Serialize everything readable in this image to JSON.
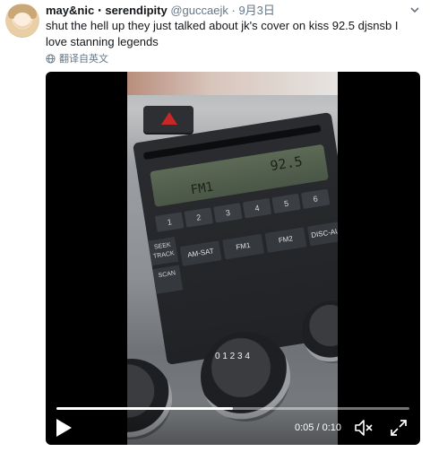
{
  "tweet": {
    "display_name": "may&nic ⋅ serendipity",
    "handle": "@guccaejk",
    "separator": "·",
    "date": "9月3日",
    "text": "shut the hell up they just talked about jk's cover on kiss 92.5 djsnsb I love stanning legends",
    "translate_label": "翻译自英文"
  },
  "video": {
    "current_time": "0:05",
    "total_time": "0:10",
    "time_separator": " / ",
    "progress_fraction": 0.5,
    "frame_text": {
      "band": "FM1",
      "frequency": "92.5",
      "presets": [
        "1",
        "2",
        "3",
        "4",
        "5",
        "6"
      ],
      "mode_buttons": [
        "AM-SAT",
        "FM1",
        "FM2",
        "DISC-AUX"
      ],
      "side_buttons": [
        "SEEK TRACK",
        "SCAN"
      ],
      "knob_numbers": "0 1 2 3 4"
    }
  },
  "icons": {
    "caret": "chevron-down-icon",
    "translate": "globe-icon",
    "play": "play-icon",
    "mute": "volume-muted-icon",
    "fullscreen": "fullscreen-icon"
  },
  "colors": {
    "name": "#14171a",
    "meta": "#657786",
    "video_bg": "#000000",
    "hazard": "#c62828"
  }
}
